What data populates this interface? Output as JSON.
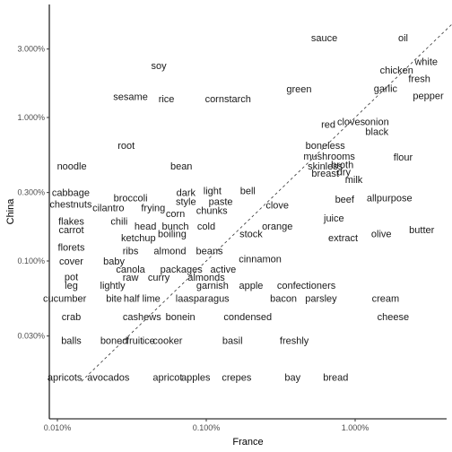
{
  "chart_data": {
    "type": "scatter",
    "subtype": "text-labels",
    "title": "",
    "xlabel": "France",
    "ylabel": "China",
    "x_scale": "log10",
    "y_scale": "log10",
    "xlim_percent": [
      0.0085,
      4.5
    ],
    "ylim_percent": [
      0.0145,
      5.0
    ],
    "x_ticks": [
      {
        "value": 0.01,
        "label": "0.010%"
      },
      {
        "value": 0.1,
        "label": "0.100%"
      },
      {
        "value": 1.0,
        "label": "1.000%"
      }
    ],
    "y_ticks": [
      {
        "value": 0.03,
        "label": "0.030%"
      },
      {
        "value": 0.1,
        "label": "0.100%"
      },
      {
        "value": 0.3,
        "label": "0.300%"
      },
      {
        "value": 1.0,
        "label": "1.000%"
      },
      {
        "value": 3.0,
        "label": "3.000%"
      }
    ],
    "reference_line": {
      "type": "y=x",
      "style": "dashed"
    },
    "grid": false,
    "points": [
      {
        "word": "sauce",
        "x": 0.62,
        "y": 3.6
      },
      {
        "word": "oil",
        "x": 2.1,
        "y": 3.6
      },
      {
        "word": "soy",
        "x": 0.048,
        "y": 2.3
      },
      {
        "word": "chicken",
        "x": 1.9,
        "y": 2.15
      },
      {
        "word": "white",
        "x": 3.0,
        "y": 2.45
      },
      {
        "word": "fresh",
        "x": 2.7,
        "y": 1.87
      },
      {
        "word": "garlic",
        "x": 1.6,
        "y": 1.6
      },
      {
        "word": "pepper",
        "x": 3.1,
        "y": 1.42
      },
      {
        "word": "green",
        "x": 0.42,
        "y": 1.58
      },
      {
        "word": "sesame",
        "x": 0.031,
        "y": 1.4
      },
      {
        "word": "rice",
        "x": 0.054,
        "y": 1.35
      },
      {
        "word": "cornstarch",
        "x": 0.14,
        "y": 1.35
      },
      {
        "word": "red",
        "x": 0.66,
        "y": 0.9
      },
      {
        "word": "cloves",
        "x": 0.94,
        "y": 0.94
      },
      {
        "word": "onion",
        "x": 1.4,
        "y": 0.94
      },
      {
        "word": "black",
        "x": 1.4,
        "y": 0.8
      },
      {
        "word": "root",
        "x": 0.029,
        "y": 0.64
      },
      {
        "word": "boneless",
        "x": 0.63,
        "y": 0.64
      },
      {
        "word": "mushrooms",
        "x": 0.67,
        "y": 0.54
      },
      {
        "word": "flour",
        "x": 2.1,
        "y": 0.53
      },
      {
        "word": "noodle",
        "x": 0.0125,
        "y": 0.46
      },
      {
        "word": "bean",
        "x": 0.068,
        "y": 0.46
      },
      {
        "word": "skinless",
        "x": 0.63,
        "y": 0.46
      },
      {
        "word": "broth",
        "x": 0.82,
        "y": 0.47
      },
      {
        "word": "breast",
        "x": 0.63,
        "y": 0.41
      },
      {
        "word": "dry",
        "x": 0.84,
        "y": 0.42
      },
      {
        "word": "milk",
        "x": 0.98,
        "y": 0.37
      },
      {
        "word": "cabbage",
        "x": 0.0123,
        "y": 0.3
      },
      {
        "word": "dark",
        "x": 0.073,
        "y": 0.3
      },
      {
        "word": "light",
        "x": 0.11,
        "y": 0.31
      },
      {
        "word": "bell",
        "x": 0.19,
        "y": 0.31
      },
      {
        "word": "chestnuts",
        "x": 0.0123,
        "y": 0.25
      },
      {
        "word": "broccoli",
        "x": 0.031,
        "y": 0.275
      },
      {
        "word": "style",
        "x": 0.073,
        "y": 0.26
      },
      {
        "word": "paste",
        "x": 0.125,
        "y": 0.26
      },
      {
        "word": "allpurpose",
        "x": 1.7,
        "y": 0.275
      },
      {
        "word": "beef",
        "x": 0.85,
        "y": 0.27
      },
      {
        "word": "clove",
        "x": 0.3,
        "y": 0.245
      },
      {
        "word": "cilantro",
        "x": 0.022,
        "y": 0.235
      },
      {
        "word": "frying",
        "x": 0.044,
        "y": 0.235
      },
      {
        "word": "chunks",
        "x": 0.109,
        "y": 0.225
      },
      {
        "word": "corn",
        "x": 0.062,
        "y": 0.215
      },
      {
        "word": "juice",
        "x": 0.72,
        "y": 0.2
      },
      {
        "word": "flakes",
        "x": 0.0124,
        "y": 0.19
      },
      {
        "word": "chili",
        "x": 0.026,
        "y": 0.19
      },
      {
        "word": "head",
        "x": 0.039,
        "y": 0.175
      },
      {
        "word": "bunch",
        "x": 0.062,
        "y": 0.175
      },
      {
        "word": "cold",
        "x": 0.1,
        "y": 0.175
      },
      {
        "word": "orange",
        "x": 0.3,
        "y": 0.175
      },
      {
        "word": "butter",
        "x": 2.8,
        "y": 0.165
      },
      {
        "word": "carrot",
        "x": 0.0124,
        "y": 0.165
      },
      {
        "word": "boiling",
        "x": 0.059,
        "y": 0.155
      },
      {
        "word": "stock",
        "x": 0.2,
        "y": 0.155
      },
      {
        "word": "olive",
        "x": 1.5,
        "y": 0.155
      },
      {
        "word": "extract",
        "x": 0.83,
        "y": 0.145
      },
      {
        "word": "ketchup",
        "x": 0.035,
        "y": 0.145
      },
      {
        "word": "florets",
        "x": 0.0124,
        "y": 0.125
      },
      {
        "word": "ribs",
        "x": 0.031,
        "y": 0.118
      },
      {
        "word": "almond",
        "x": 0.057,
        "y": 0.118
      },
      {
        "word": "beans",
        "x": 0.105,
        "y": 0.118
      },
      {
        "word": "cinnamon",
        "x": 0.23,
        "y": 0.104
      },
      {
        "word": "cover",
        "x": 0.0124,
        "y": 0.1
      },
      {
        "word": "baby",
        "x": 0.024,
        "y": 0.1
      },
      {
        "word": "canola",
        "x": 0.031,
        "y": 0.088
      },
      {
        "word": "packages",
        "x": 0.068,
        "y": 0.088
      },
      {
        "word": "active",
        "x": 0.13,
        "y": 0.088
      },
      {
        "word": "pot",
        "x": 0.0124,
        "y": 0.078
      },
      {
        "word": "raw",
        "x": 0.031,
        "y": 0.077
      },
      {
        "word": "curry",
        "x": 0.048,
        "y": 0.077
      },
      {
        "word": "almonds",
        "x": 0.1,
        "y": 0.077
      },
      {
        "word": "leg",
        "x": 0.0124,
        "y": 0.068
      },
      {
        "word": "lightly",
        "x": 0.0235,
        "y": 0.068
      },
      {
        "word": "garnish",
        "x": 0.11,
        "y": 0.068
      },
      {
        "word": "apple",
        "x": 0.2,
        "y": 0.068
      },
      {
        "word": "confectioners",
        "x": 0.47,
        "y": 0.068
      },
      {
        "word": "cucumber",
        "x": 0.0112,
        "y": 0.055
      },
      {
        "word": "bite",
        "x": 0.024,
        "y": 0.055
      },
      {
        "word": "half lime",
        "x": 0.037,
        "y": 0.055
      },
      {
        "word": "la",
        "x": 0.066,
        "y": 0.055
      },
      {
        "word": "asparagus",
        "x": 0.1,
        "y": 0.055
      },
      {
        "word": "bacon",
        "x": 0.33,
        "y": 0.055
      },
      {
        "word": "parsley",
        "x": 0.59,
        "y": 0.055
      },
      {
        "word": "cream",
        "x": 1.6,
        "y": 0.055
      },
      {
        "word": "crab",
        "x": 0.0124,
        "y": 0.041
      },
      {
        "word": "cashews",
        "x": 0.037,
        "y": 0.041
      },
      {
        "word": "bonein",
        "x": 0.067,
        "y": 0.041
      },
      {
        "word": "condensed",
        "x": 0.19,
        "y": 0.041
      },
      {
        "word": "cheese",
        "x": 1.8,
        "y": 0.041
      },
      {
        "word": "balls",
        "x": 0.0124,
        "y": 0.028
      },
      {
        "word": "boned",
        "x": 0.024,
        "y": 0.028
      },
      {
        "word": "fruit",
        "x": 0.033,
        "y": 0.028
      },
      {
        "word": "ice",
        "x": 0.041,
        "y": 0.028
      },
      {
        "word": "cooker",
        "x": 0.055,
        "y": 0.028
      },
      {
        "word": "basil",
        "x": 0.15,
        "y": 0.028
      },
      {
        "word": "freshly",
        "x": 0.39,
        "y": 0.028
      },
      {
        "word": "apricots",
        "x": 0.0112,
        "y": 0.0155
      },
      {
        "word": "avocados",
        "x": 0.022,
        "y": 0.0155
      },
      {
        "word": "apricot",
        "x": 0.055,
        "y": 0.0155
      },
      {
        "word": "apples",
        "x": 0.085,
        "y": 0.0155
      },
      {
        "word": "crepes",
        "x": 0.16,
        "y": 0.0155
      },
      {
        "word": "bay",
        "x": 0.38,
        "y": 0.0155
      },
      {
        "word": "bread",
        "x": 0.74,
        "y": 0.0155
      }
    ]
  }
}
